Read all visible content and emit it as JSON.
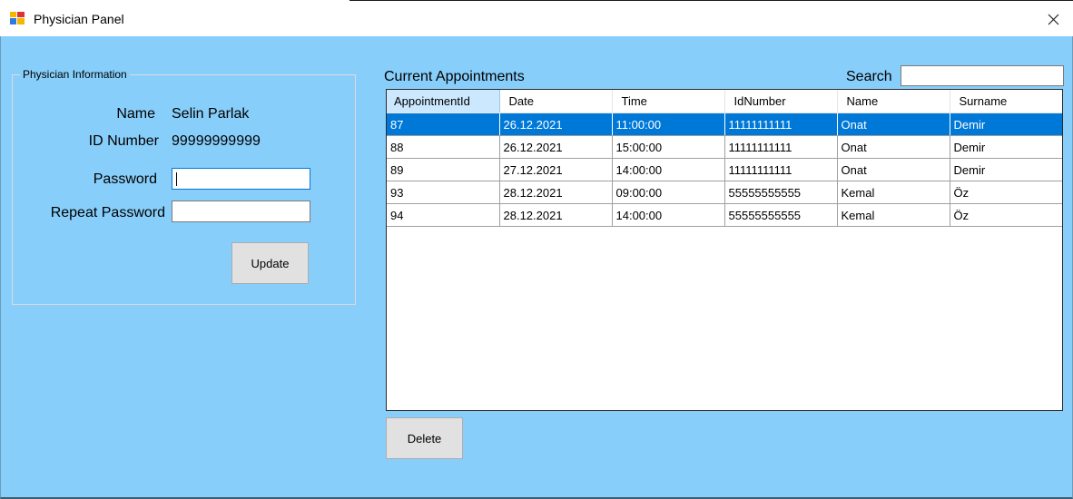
{
  "window": {
    "title": "Physician Panel",
    "icon": "app-window-icon",
    "close_icon": "close-icon"
  },
  "colors": {
    "client_background": "#87cefa",
    "selection": "#0078d7",
    "header_highlight": "#cce8ff"
  },
  "physician_info": {
    "group_title": "Physician Information",
    "name_label": "Name",
    "name_value": "Selin Parlak",
    "id_label": "ID Number",
    "id_value": "99999999999",
    "password_label": "Password",
    "password_value": "",
    "repeat_password_label": "Repeat Password",
    "repeat_password_value": "",
    "update_button": "Update"
  },
  "appointments": {
    "title": "Current Appointments",
    "search_label": "Search",
    "search_value": "",
    "columns": [
      "AppointmentId",
      "Date",
      "Time",
      "IdNumber",
      "Name",
      "Surname"
    ],
    "rows": [
      [
        "87",
        "26.12.2021",
        "11:00:00",
        "11111111111",
        "Onat",
        "Demir"
      ],
      [
        "88",
        "26.12.2021",
        "15:00:00",
        "11111111111",
        "Onat",
        "Demir"
      ],
      [
        "89",
        "27.12.2021",
        "14:00:00",
        "11111111111",
        "Onat",
        "Demir"
      ],
      [
        "93",
        "28.12.2021",
        "09:00:00",
        "55555555555",
        "Kemal",
        "Öz"
      ],
      [
        "94",
        "28.12.2021",
        "14:00:00",
        "55555555555",
        "Kemal",
        "Öz"
      ]
    ],
    "selected_row": 0,
    "delete_button": "Delete"
  }
}
